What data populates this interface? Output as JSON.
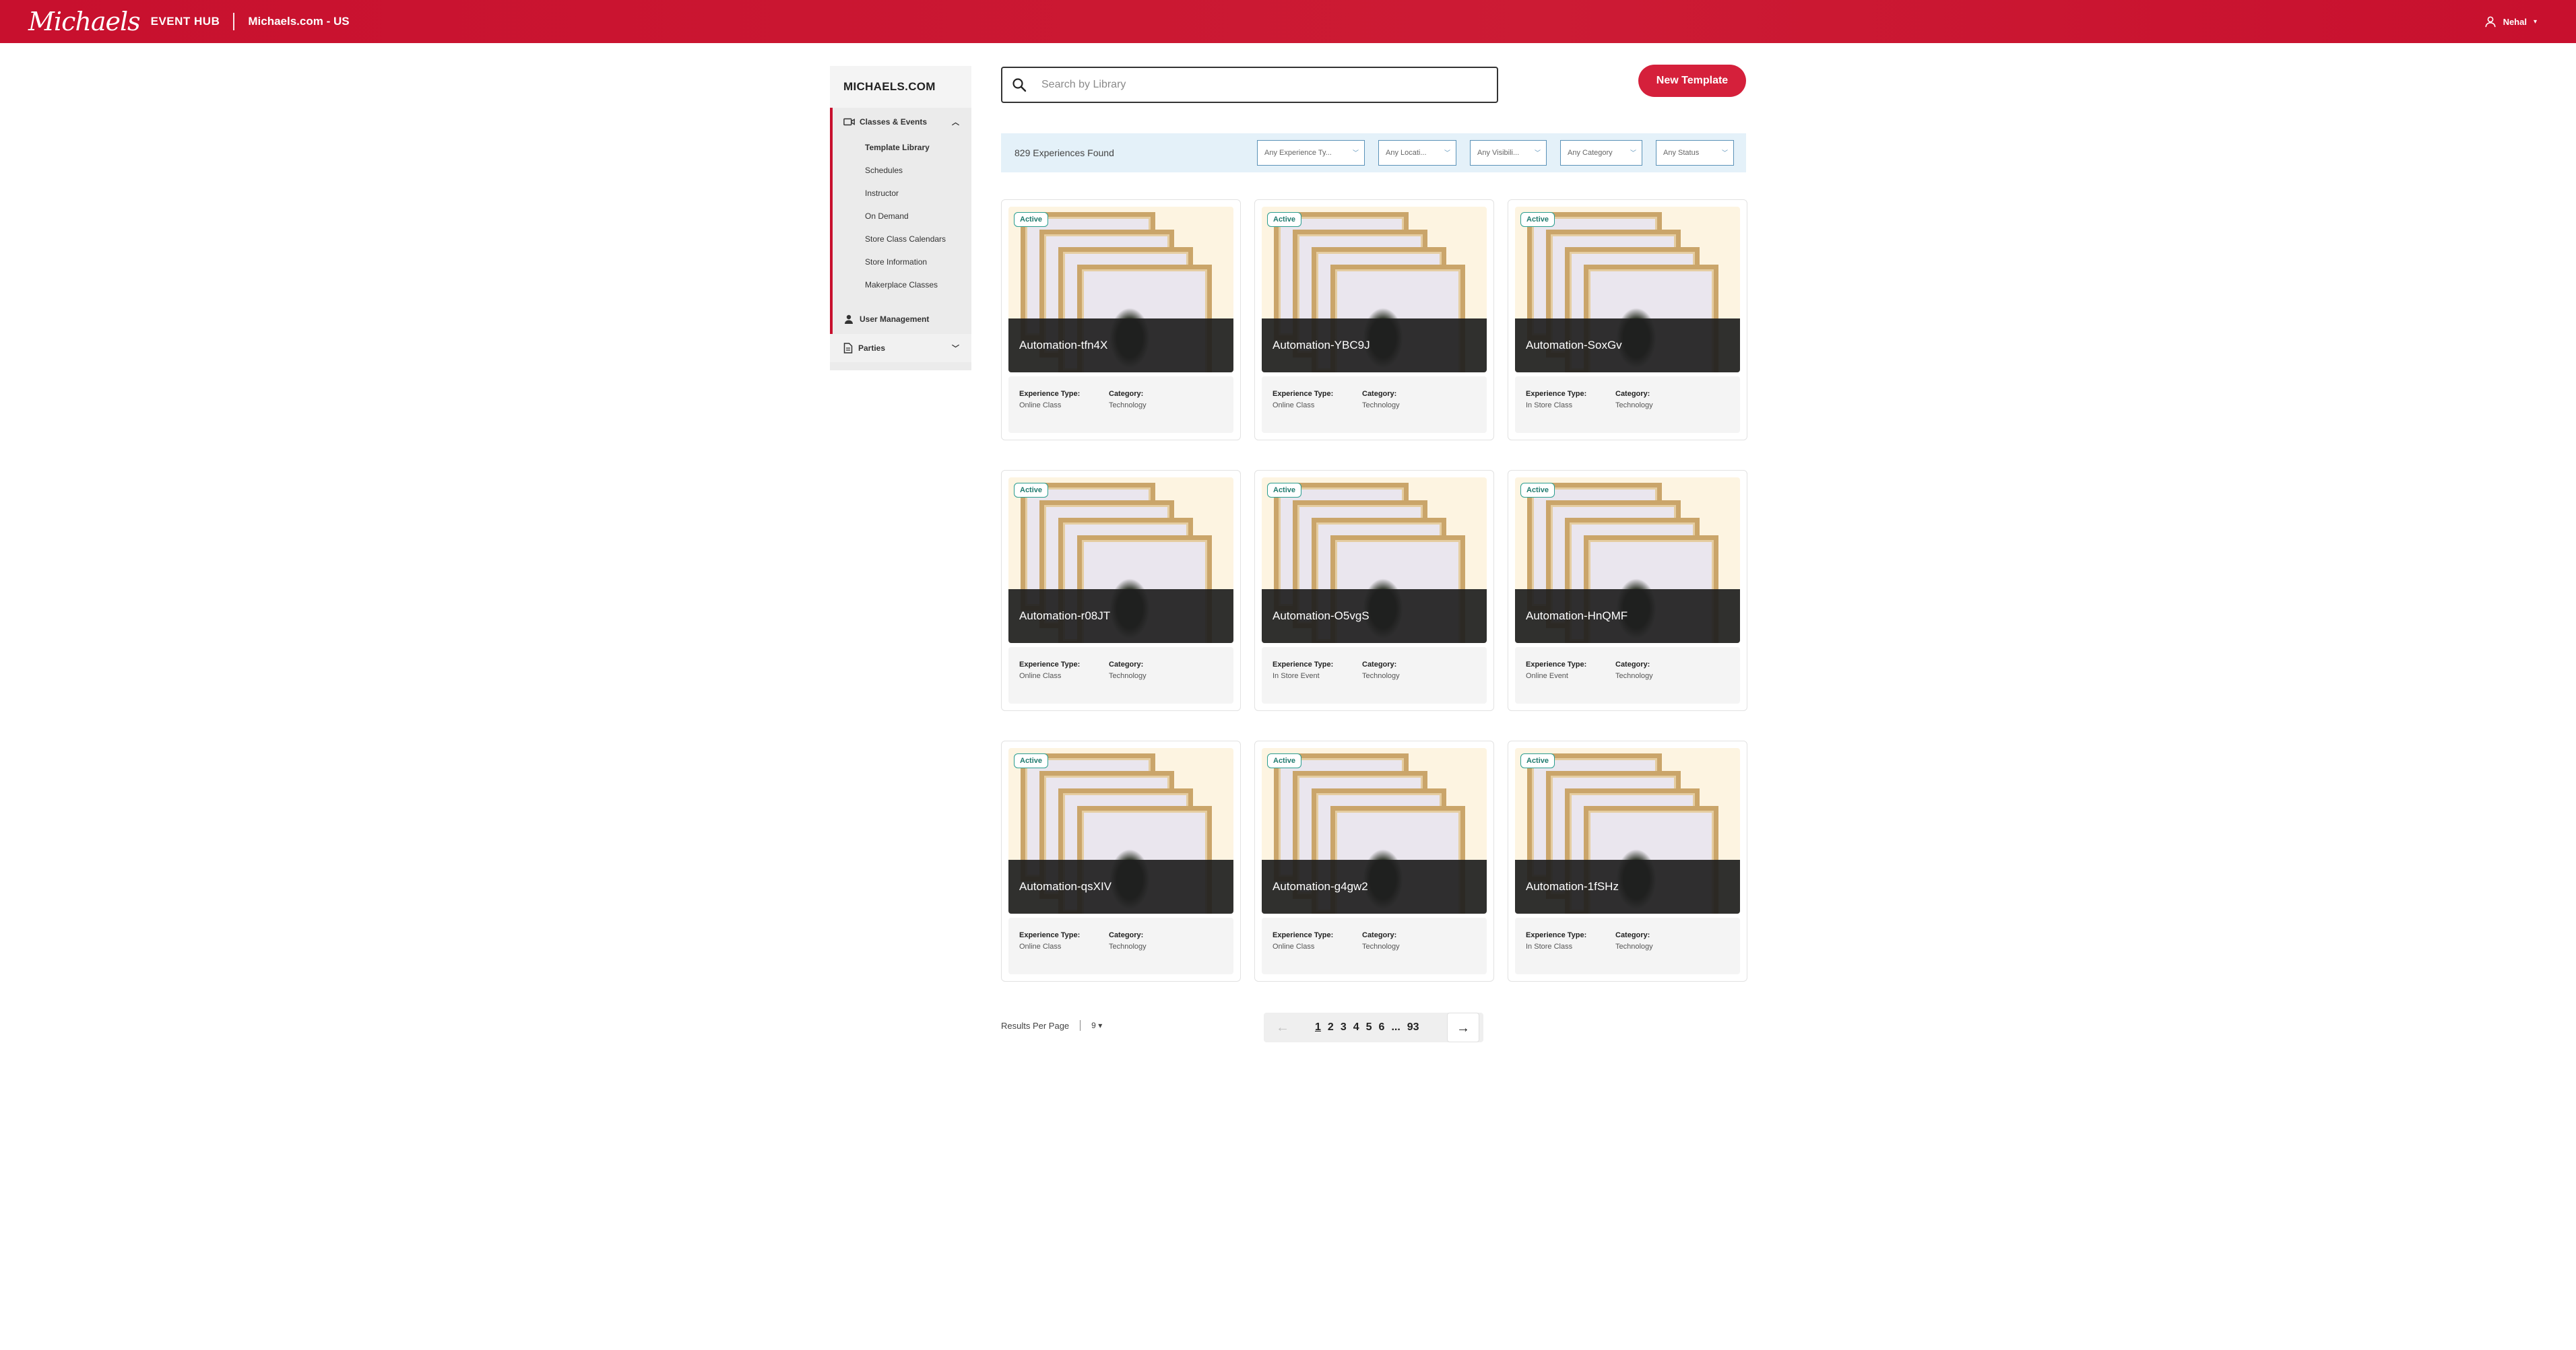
{
  "header": {
    "brand": "Michaels",
    "hub": "EVENT HUB",
    "site": "Michaels.com - US",
    "user": "Nehal"
  },
  "sidebar": {
    "title": "MICHAELS.COM",
    "group_label": "Classes & Events",
    "items": [
      {
        "label": "Template Library"
      },
      {
        "label": "Schedules"
      },
      {
        "label": "Instructor"
      },
      {
        "label": "On Demand"
      },
      {
        "label": "Store Class Calendars"
      },
      {
        "label": "Store Information"
      },
      {
        "label": "Makerplace Classes"
      }
    ],
    "user_management": "User Management",
    "parties": "Parties"
  },
  "search": {
    "placeholder": "Search by Library"
  },
  "new_template": "New Template",
  "results": {
    "found": "829 Experiences Found",
    "filters": [
      "Any Experience Ty...",
      "Any Locati...",
      "Any Visibili...",
      "Any Category",
      "Any Status"
    ]
  },
  "cards": [
    {
      "status": "Active",
      "title": "Automation-tfn4X",
      "exp_label": "Experience Type:",
      "exp": "Online Class",
      "cat_label": "Category:",
      "cat": "Technology"
    },
    {
      "status": "Active",
      "title": "Automation-YBC9J",
      "exp_label": "Experience Type:",
      "exp": "Online Class",
      "cat_label": "Category:",
      "cat": "Technology"
    },
    {
      "status": "Active",
      "title": "Automation-SoxGv",
      "exp_label": "Experience Type:",
      "exp": "In Store Class",
      "cat_label": "Category:",
      "cat": "Technology"
    },
    {
      "status": "Active",
      "title": "Automation-r08JT",
      "exp_label": "Experience Type:",
      "exp": "Online Class",
      "cat_label": "Category:",
      "cat": "Technology"
    },
    {
      "status": "Active",
      "title": "Automation-O5vgS",
      "exp_label": "Experience Type:",
      "exp": "In Store Event",
      "cat_label": "Category:",
      "cat": "Technology"
    },
    {
      "status": "Active",
      "title": "Automation-HnQMF",
      "exp_label": "Experience Type:",
      "exp": "Online Event",
      "cat_label": "Category:",
      "cat": "Technology"
    },
    {
      "status": "Active",
      "title": "Automation-qsXIV",
      "exp_label": "Experience Type:",
      "exp": "Online Class",
      "cat_label": "Category:",
      "cat": "Technology"
    },
    {
      "status": "Active",
      "title": "Automation-g4gw2",
      "exp_label": "Experience Type:",
      "exp": "Online Class",
      "cat_label": "Category:",
      "cat": "Technology"
    },
    {
      "status": "Active",
      "title": "Automation-1fSHz",
      "exp_label": "Experience Type:",
      "exp": "In Store Class",
      "cat_label": "Category:",
      "cat": "Technology"
    }
  ],
  "footer": {
    "results_per_page_label": "Results Per Page",
    "results_per_page": "9",
    "pages": [
      "1",
      "2",
      "3",
      "4",
      "5",
      "6",
      "...",
      "93"
    ],
    "current_page": "1"
  },
  "colors": {
    "brand_red": "#c8102e",
    "accent": "#d5203b",
    "active_badge": "#2a9d8f"
  },
  "icons": {
    "search": "search-icon",
    "user": "user-icon",
    "prev": "arrow-left-icon",
    "next": "arrow-right-icon"
  }
}
